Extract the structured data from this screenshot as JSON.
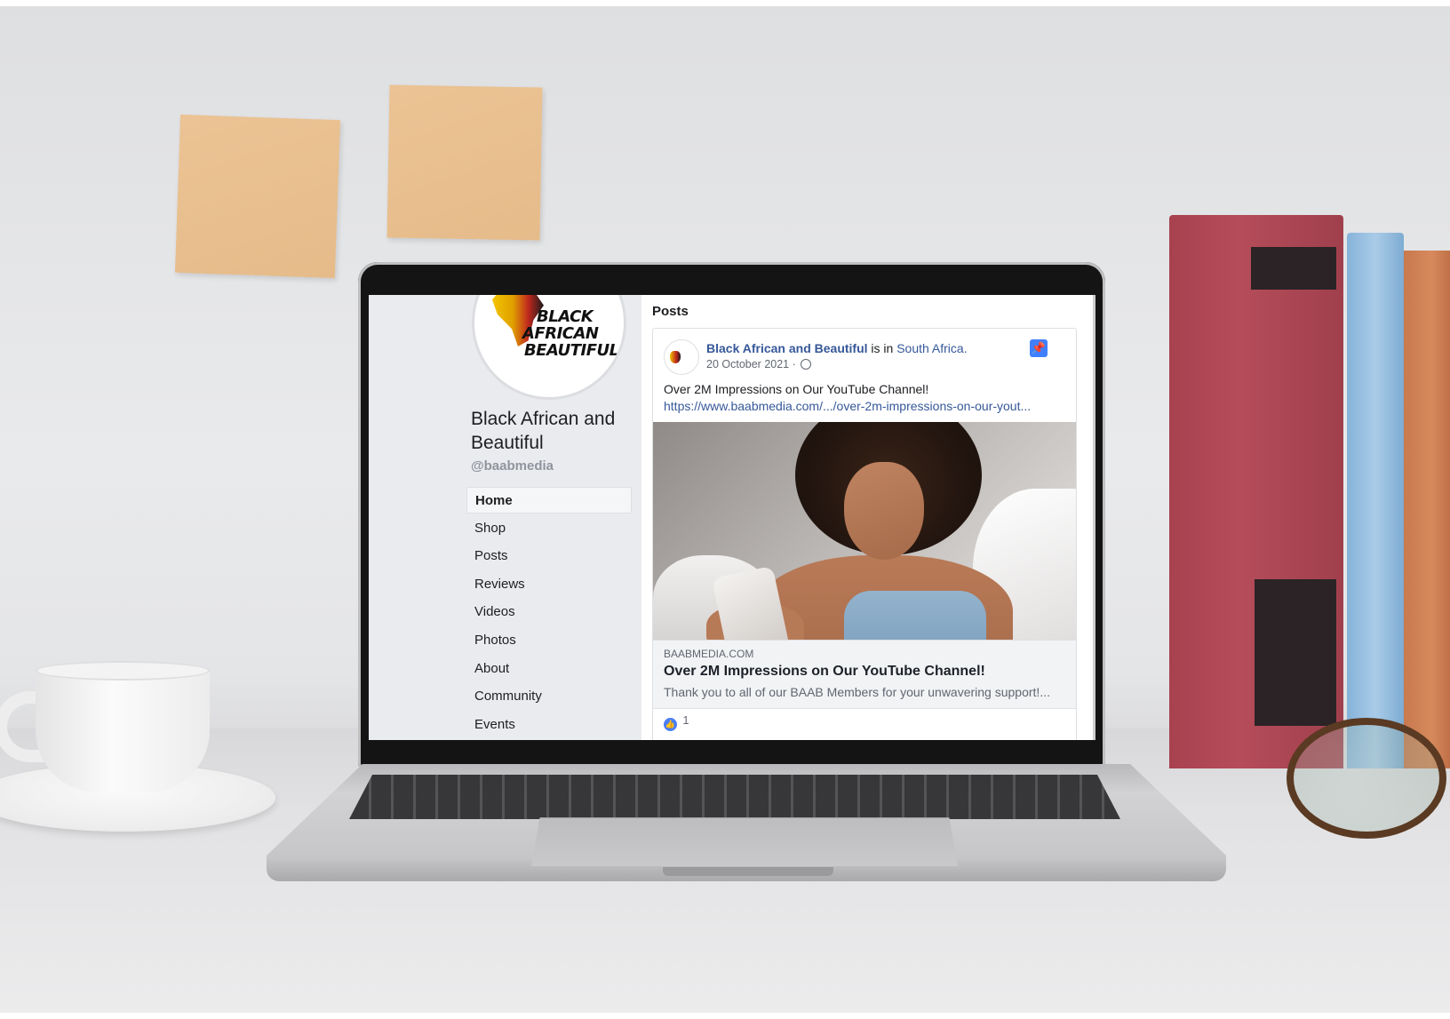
{
  "page": {
    "logo_text": [
      "BLACK",
      "AFRICAN",
      "BEAUTIFUL"
    ],
    "name": "Black African and Beautiful",
    "handle": "@baabmedia"
  },
  "nav": {
    "items": [
      {
        "label": "Home",
        "active": true
      },
      {
        "label": "Shop",
        "active": false
      },
      {
        "label": "Posts",
        "active": false
      },
      {
        "label": "Reviews",
        "active": false
      },
      {
        "label": "Videos",
        "active": false
      },
      {
        "label": "Photos",
        "active": false
      },
      {
        "label": "About",
        "active": false
      },
      {
        "label": "Community",
        "active": false
      },
      {
        "label": "Events",
        "active": false
      }
    ]
  },
  "main": {
    "section_title": "Posts"
  },
  "post": {
    "author": "Black African and Beautiful",
    "location_prefix": "is in",
    "location": "South Africa.",
    "date": "20 October 2021 ·",
    "audience_icon": "globe-icon",
    "pinned_icon": "pin-icon",
    "text": "Over 2M Impressions on Our YouTube Channel!",
    "url": "https://www.baabmedia.com/.../over-2m-impressions-on-our-yout...",
    "link_preview": {
      "domain": "BAABMEDIA.COM",
      "title": "Over 2M Impressions on Our YouTube Channel!",
      "description": "Thank you to all of our BAAB Members for your unwavering support!..."
    },
    "reactions": {
      "icon": "like-icon",
      "count": "1"
    }
  },
  "colors": {
    "link_blue": "#365899",
    "sidebar_bg": "#e9ebee",
    "pin_blue": "#4080ff"
  }
}
